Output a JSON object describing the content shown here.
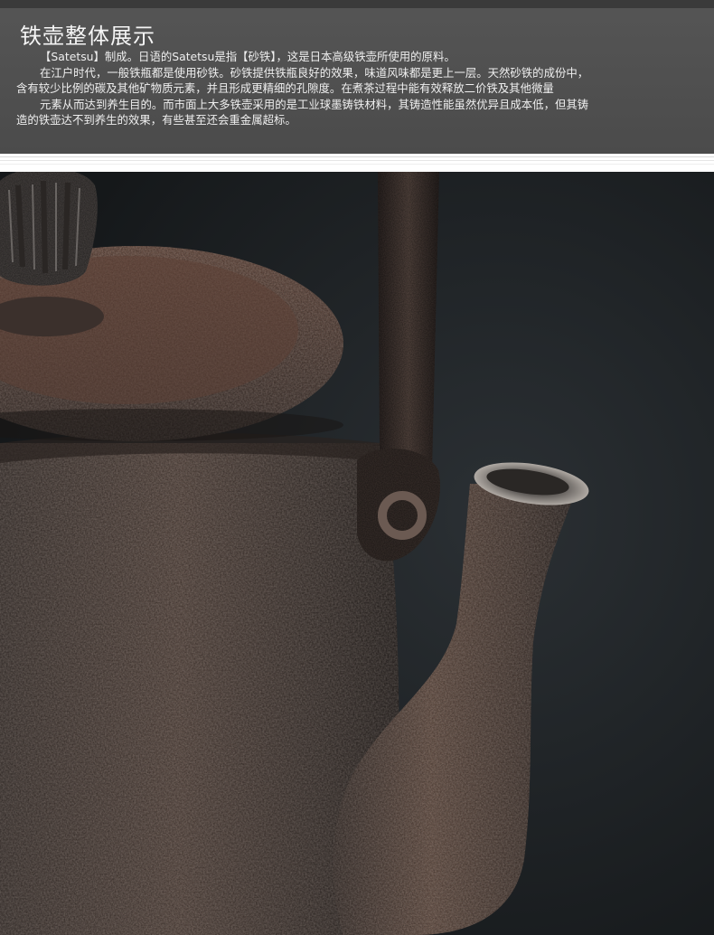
{
  "header": {
    "title": "铁壶整体展示",
    "paragraphs": [
      "【Satetsu】制成。日语的Satetsu是指【砂铁】，这是日本高级铁壶所使用的原料。",
      "在江户时代，一般铁瓶都是使用砂铁。砂铁提供铁瓶良好的效果，味道风味都是更上一层。天然砂铁的成份中，",
      "含有较少比例的碳及其他矿物质元素，并且形成更精细的孔隙度。在煮茶过程中能有效释放二价铁及其他微量",
      "元素从而达到养生目的。而市面上大多铁壶采用的是工业球墨铸铁材料，其铸造性能虽然优异且成本低，但其铸",
      "造的铁壶达不到养生的效果，有些甚至还会重金属超标。"
    ]
  },
  "colors": {
    "header_bg": "#4f4f4f",
    "photo_bg": "#1b1f22",
    "iron": "#4a3d37",
    "rust": "#6b4a3b",
    "spout_rim": "#9a9590"
  },
  "photo": {
    "subject": "cast-iron-teapot-closeup"
  }
}
